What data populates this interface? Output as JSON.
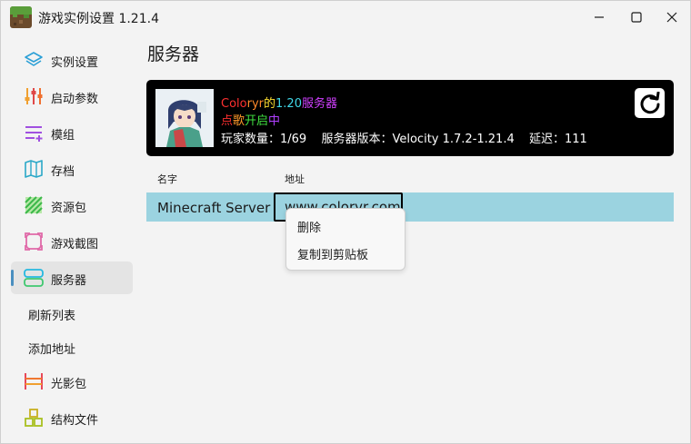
{
  "window": {
    "title": "游戏实例设置 1.21.4"
  },
  "sidebar": {
    "items": [
      {
        "label": "实例设置",
        "icon": "layers-icon"
      },
      {
        "label": "启动参数",
        "icon": "sliders-icon"
      },
      {
        "label": "模组",
        "icon": "list-add-icon"
      },
      {
        "label": "存档",
        "icon": "map-icon"
      },
      {
        "label": "资源包",
        "icon": "texture-icon"
      },
      {
        "label": "游戏截图",
        "icon": "screenshot-icon"
      },
      {
        "label": "服务器",
        "icon": "server-icon"
      },
      {
        "label": "光影包",
        "icon": "shader-icon"
      },
      {
        "label": "结构文件",
        "icon": "blocks-icon"
      }
    ],
    "sub_items": [
      "刷新列表",
      "添加地址"
    ]
  },
  "main": {
    "title": "服务器",
    "server": {
      "motd_line1_parts": [
        "Colo",
        "ryr",
        "的",
        "1.20",
        "服务器"
      ],
      "motd_line2_parts": [
        "点",
        "歌",
        "开启",
        "中"
      ],
      "players": "玩家数量：1/69",
      "version": "服务器版本：Velocity 1.7.2-1.21.4",
      "latency": "延迟：111"
    },
    "columns": [
      "名字",
      "地址"
    ],
    "rows": [
      {
        "name": "Minecraft Server",
        "address": "www.colorvr.com"
      }
    ],
    "context_menu": [
      "删除",
      "复制到剪贴板"
    ]
  },
  "colors": {
    "selected_row": "#9bd3e0",
    "accent": "#4a8fc0",
    "card_bg": "#000000"
  }
}
